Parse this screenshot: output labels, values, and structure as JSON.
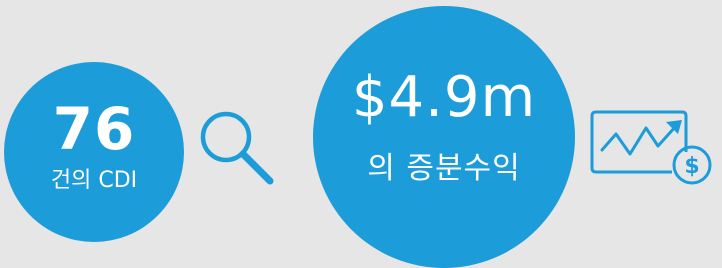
{
  "colors": {
    "background": "#e6e6e6",
    "accent": "#1c9cd8"
  },
  "stats": [
    {
      "value": "76",
      "label": "건의 CDI",
      "icon": "search-icon"
    },
    {
      "value": "$4.9m",
      "label": "의 증분수익",
      "icon": "chart-dollar-icon"
    }
  ]
}
